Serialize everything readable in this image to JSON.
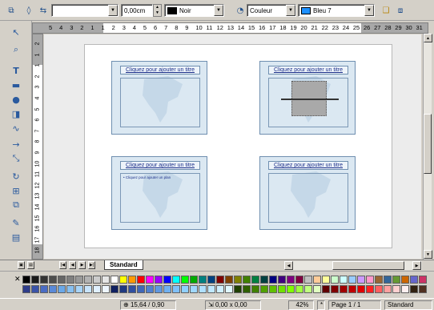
{
  "toolbar": {
    "line_width_value": "0,00cm",
    "line_color_value": "Noir",
    "line_color_hex": "#000000",
    "area_style_value": "Couleur",
    "area_color_value": "Bleu 7",
    "area_color_hex": "#1e90ff"
  },
  "ruler": {
    "horizontal_ticks": [
      "5",
      "4",
      "3",
      "2",
      "1",
      "1",
      "2",
      "3",
      "4",
      "5",
      "6",
      "7",
      "8",
      "9",
      "10",
      "11",
      "12",
      "13",
      "14",
      "15",
      "16",
      "17",
      "18",
      "19",
      "20",
      "21",
      "22",
      "23",
      "24",
      "25",
      "26",
      "27",
      "28",
      "29",
      "30",
      "31"
    ],
    "vertical_ticks": [
      "2",
      "1",
      "1",
      "2",
      "3",
      "4",
      "5",
      "6",
      "7",
      "8",
      "9",
      "10",
      "11",
      "12",
      "13",
      "14",
      "15",
      "16",
      "17",
      "18",
      "19"
    ]
  },
  "slides": [
    {
      "title": "Cliquez pour ajouter un titre",
      "bullet": ""
    },
    {
      "title": "Cliquez pour ajouter un titre",
      "bullet": ""
    },
    {
      "title": "Cliquez pour ajouter un titre",
      "bullet": "• Cliquez pour ajouter un plan"
    },
    {
      "title": "Cliquez pour ajouter un titre",
      "bullet": ""
    }
  ],
  "tabs": {
    "active_tab": "Standard"
  },
  "palette": {
    "row1": [
      "#000000",
      "#1a1a1a",
      "#333333",
      "#4d4d4d",
      "#666666",
      "#808080",
      "#999999",
      "#b3b3b3",
      "#cccccc",
      "#e6e6e6",
      "#ffffff",
      "#ffff00",
      "#ff9900",
      "#ff0000",
      "#ff00ff",
      "#9900ff",
      "#0000ff",
      "#00ffff",
      "#00ff00",
      "#00aa00",
      "#008080",
      "#004080",
      "#800000",
      "#804000",
      "#808000",
      "#408000",
      "#008040",
      "#004040",
      "#000080",
      "#400080",
      "#800080",
      "#800040",
      "#c0c0c0",
      "#ffcc99",
      "#ffff99",
      "#ccffcc",
      "#ccffff",
      "#99ccff",
      "#cc99ff",
      "#ff99cc",
      "#996633",
      "#336699",
      "#669933",
      "#cc6600",
      "#6666cc",
      "#cc3366"
    ],
    "row2": [
      "#2f3d8a",
      "#3a53a8",
      "#4a6cc4",
      "#5a8ad8",
      "#6aa8e8",
      "#88c0f0",
      "#a8d4f8",
      "#c8e4fc",
      "#e0f0fe",
      "#eef6ff",
      "#102060",
      "#203a80",
      "#3050a0",
      "#4068b8",
      "#5080d0",
      "#6098e0",
      "#70b0f0",
      "#80c0f8",
      "#90d0ff",
      "#a0d8ff",
      "#b0e0ff",
      "#c0e8ff",
      "#d0f0ff",
      "#e0f8ff",
      "#204000",
      "#306000",
      "#408000",
      "#50a000",
      "#60c000",
      "#70e000",
      "#80ff00",
      "#a0ff40",
      "#c0ff80",
      "#e0ffc0",
      "#600000",
      "#800000",
      "#a00000",
      "#c00000",
      "#e00000",
      "#ff2020",
      "#ff6060",
      "#ffa0a0",
      "#ffd0d0",
      "#fff0f0",
      "#302010",
      "#503020"
    ]
  },
  "status": {
    "position": "15,64 / 0,90",
    "size": "0,00 x 0,00",
    "zoom": "42%",
    "page": "Page 1 / 1",
    "layout": "Standard"
  }
}
